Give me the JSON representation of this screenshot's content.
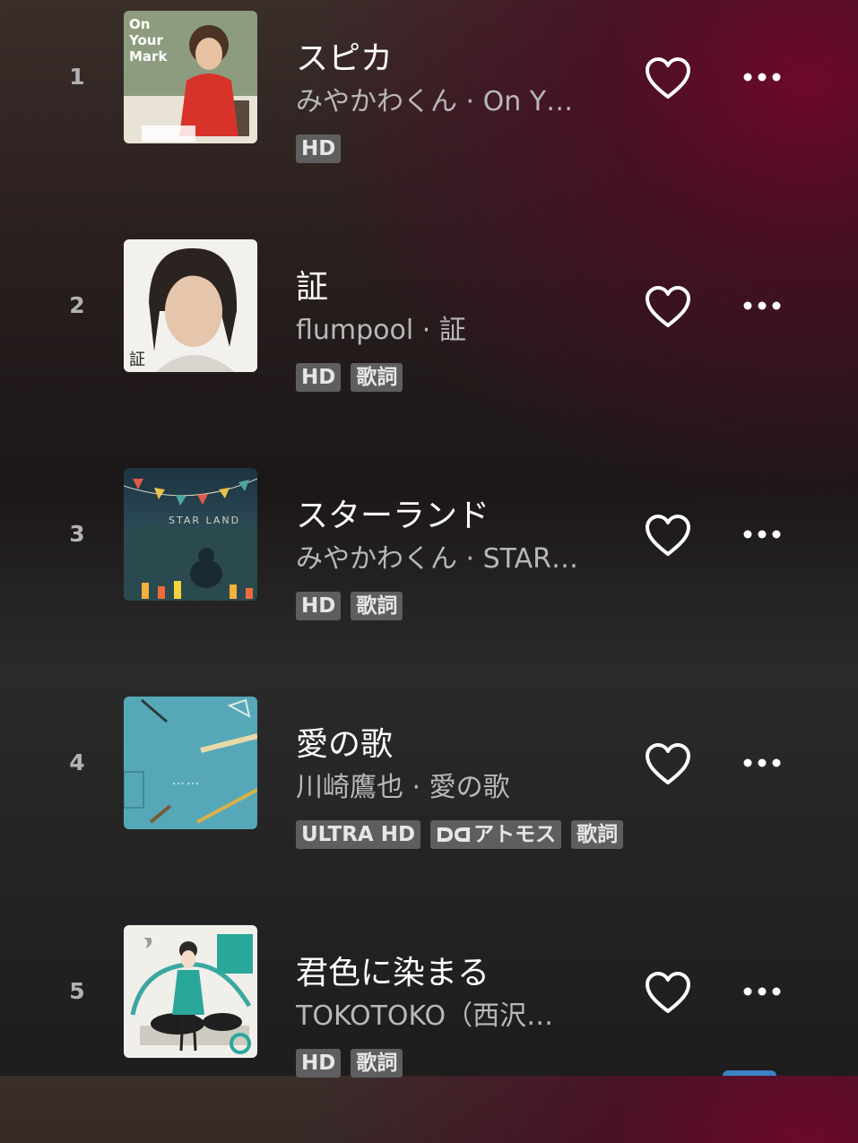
{
  "track_list": {
    "tracks": [
      {
        "number": "1",
        "title": "スピカ",
        "subtitle": "みやかわくん · On Y…",
        "badges": [
          "HD"
        ],
        "has_atmos": false,
        "art": {
          "text_lines": [
            "On",
            "Your",
            "Mark"
          ],
          "bg": "#8b9a7c"
        }
      },
      {
        "number": "2",
        "title": "証",
        "subtitle": "flumpool · 証",
        "badges": [
          "HD",
          "歌詞"
        ],
        "has_atmos": false,
        "art": {
          "text_lines": [
            "証"
          ],
          "bg": "#f3f1ee"
        }
      },
      {
        "number": "3",
        "title": "スターランド",
        "subtitle": "みやかわくん · STAR…",
        "badges": [
          "HD",
          "歌詞"
        ],
        "has_atmos": false,
        "art": {
          "text_lines": [
            "STAR LAND"
          ],
          "bg": "#2f4852"
        }
      },
      {
        "number": "4",
        "title": "愛の歌",
        "subtitle": "川崎鷹也 · 愛の歌",
        "badges": [
          "ULTRA HD",
          "アトモス",
          "歌詞"
        ],
        "has_atmos": true,
        "art": {
          "text_lines": [
            "……"
          ],
          "bg": "#56a8b8"
        }
      },
      {
        "number": "5",
        "title": "君色に染まる",
        "subtitle": "TOKOTOKO（西沢…",
        "badges": [
          "HD",
          "歌詞"
        ],
        "has_atmos": false,
        "art": {
          "text_lines": [],
          "bg": "#f1efe9"
        }
      }
    ]
  },
  "colors": {
    "accent_wine": "#70062c",
    "badge_bg": "#5e5e5e",
    "text_primary": "#ffffff",
    "text_secondary": "#b8b8b8"
  }
}
